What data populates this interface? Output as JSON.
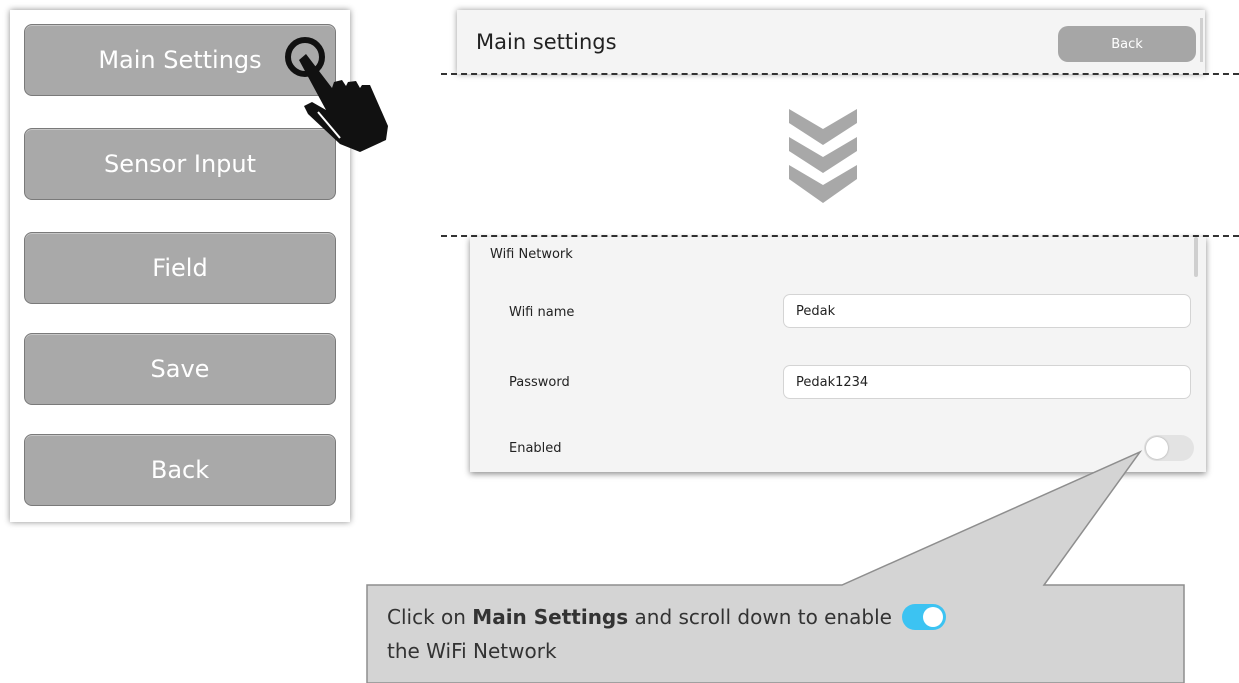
{
  "menu": {
    "buttons": [
      {
        "label": "Main Settings"
      },
      {
        "label": "Sensor Input"
      },
      {
        "label": "Field"
      },
      {
        "label": "Save"
      },
      {
        "label": "Back"
      }
    ]
  },
  "top_window": {
    "title": "Main settings",
    "back_label": "Back"
  },
  "settings": {
    "section_title": "Wifi Network",
    "wifi_name_label": "Wifi name",
    "wifi_name_value": "Pedak",
    "password_label": "Password",
    "password_value": "Pedak1234",
    "enabled_label": "Enabled",
    "enabled": false
  },
  "callout": {
    "part1": "Click on ",
    "bold": "Main Settings",
    "part2": " and scroll  down to enable ",
    "part3": " the WiFi Network"
  },
  "icons": {
    "pointer": "hand-pointer-icon",
    "scroll_down": "chevron-double-down-icon"
  },
  "colors": {
    "button_gray": "#a9a9a9",
    "toggle_on": "#3cc3f2",
    "callout_bg": "#d4d4d4"
  }
}
